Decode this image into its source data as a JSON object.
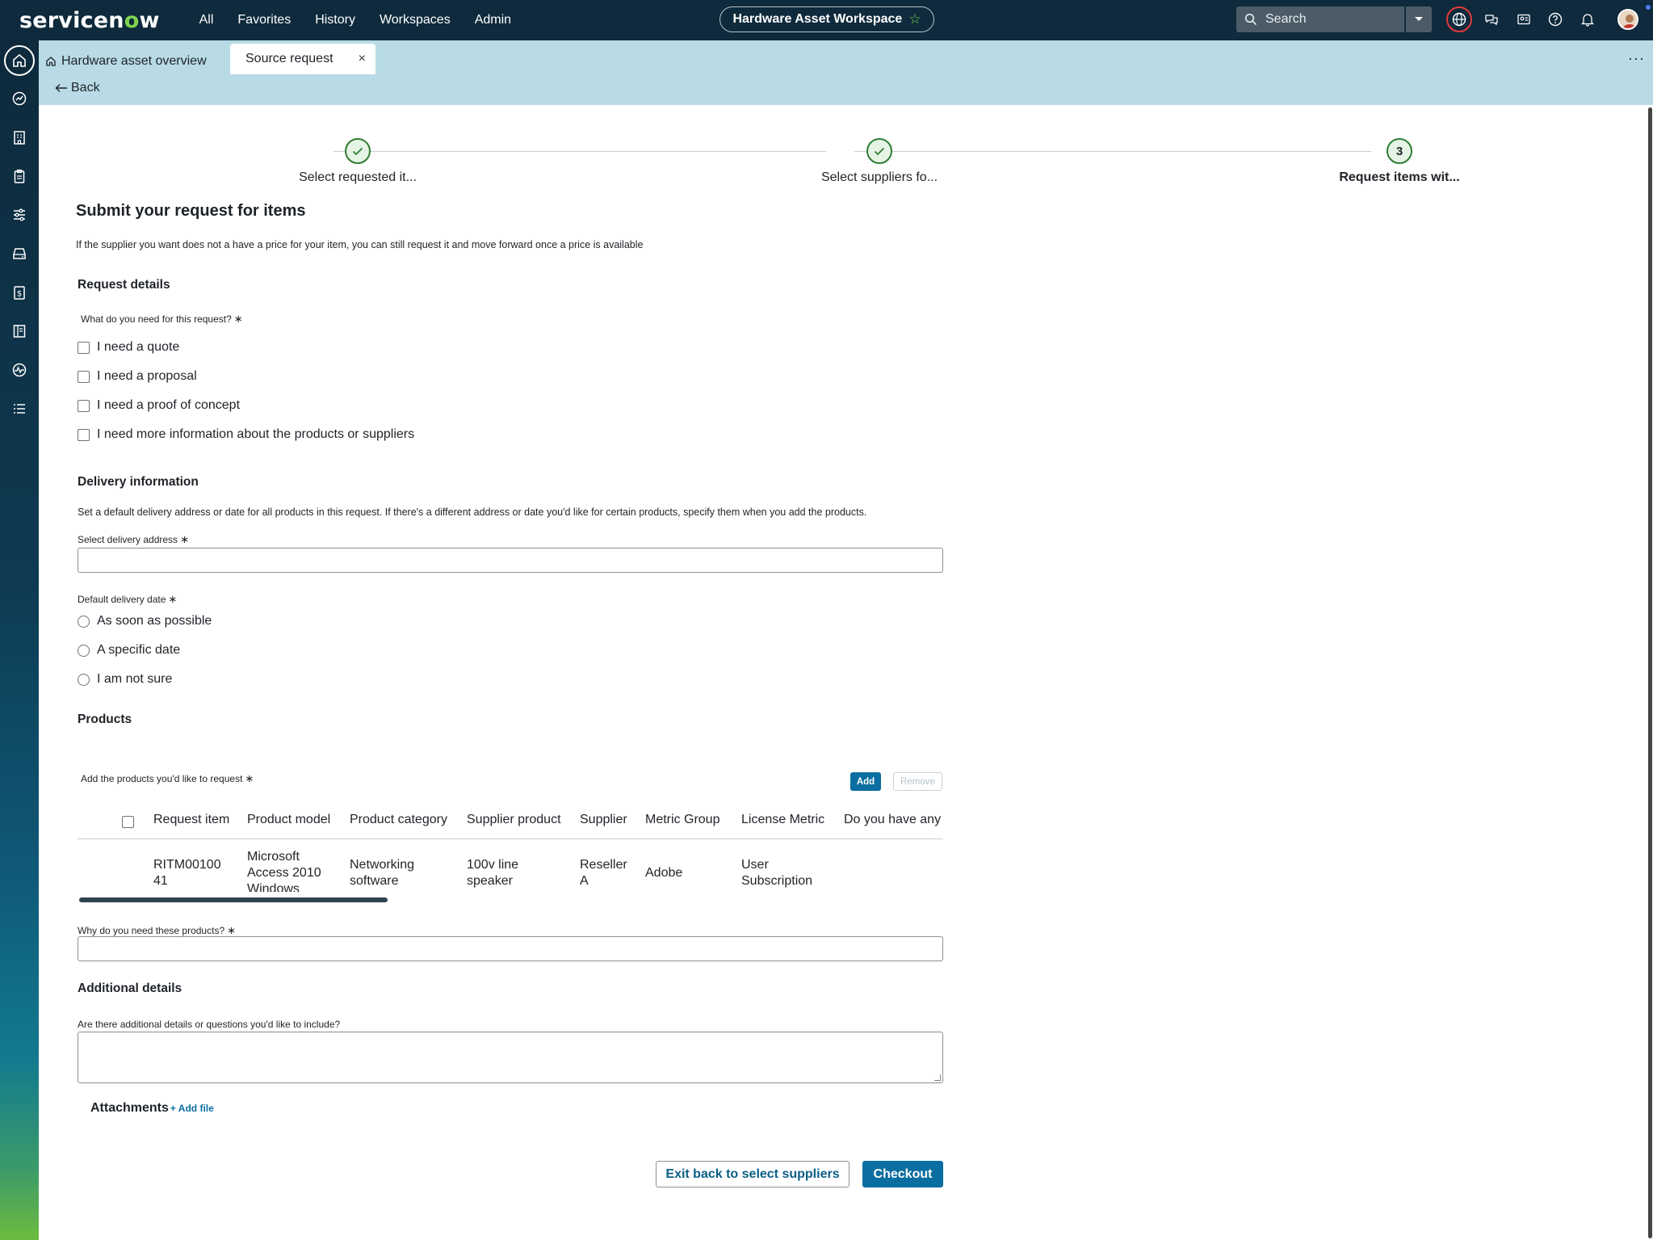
{
  "topbar": {
    "logo_main": "servicen",
    "logo_accent": "o",
    "logo_end": "w",
    "nav": [
      "All",
      "Favorites",
      "History",
      "Workspaces",
      "Admin"
    ],
    "workspace": "Hardware Asset Workspace",
    "search_placeholder": "Search"
  },
  "tabs": {
    "home": "Hardware asset overview",
    "active": "Source request",
    "close": "×",
    "back": "Back",
    "more": "···"
  },
  "stepper": [
    {
      "label": "Select requested it...",
      "state": "done"
    },
    {
      "label": "Select suppliers fo...",
      "state": "done"
    },
    {
      "label": "Request items wit...",
      "state": "current",
      "number": "3"
    }
  ],
  "form": {
    "title": "Submit your request for items",
    "subtitle": "If the supplier you want does not a have a price for your item, you can still request it and move forward once a price is available",
    "request_details": {
      "heading": "Request details",
      "question": "What do you need for this request?",
      "options": [
        "I need a quote",
        "I need a proposal",
        "I need a proof of concept",
        "I need more information about the products or suppliers"
      ]
    },
    "delivery": {
      "heading": "Delivery information",
      "description": "Set a default delivery address or date for all products in this request. If there's a different address or date you'd like for certain products, specify them when you add the products.",
      "address_label": "Select delivery address",
      "date_label": "Default delivery date",
      "date_options": [
        "As soon as possible",
        "A specific date",
        "I am not sure"
      ]
    },
    "products": {
      "heading": "Products",
      "add_label": "Add the products you'd like to request",
      "add_button": "Add",
      "remove_button": "Remove",
      "columns": [
        "Request item",
        "Product model",
        "Product category",
        "Supplier product",
        "Supplier",
        "Metric Group",
        "License Metric",
        "Do you have any r"
      ],
      "rows": [
        {
          "request_item": [
            "RITM00100",
            "41"
          ],
          "product_model": [
            "Microsoft",
            "Access 2010",
            "Windows"
          ],
          "product_category": [
            "Networking",
            "software"
          ],
          "supplier_product": [
            "100v line",
            "speaker"
          ],
          "supplier": [
            "Reseller",
            "A"
          ],
          "metric_group": "Adobe",
          "license_metric": [
            "User",
            "Subscription"
          ]
        }
      ],
      "why_label": "Why do you need these products?"
    },
    "additional": {
      "heading": "Additional details",
      "question": "Are there additional details or questions you'd like to include?"
    },
    "attachments": {
      "label": "Attachments",
      "add_file": "+ Add file"
    },
    "required_mark": "∗",
    "buttons": {
      "exit": "Exit back to select suppliers",
      "checkout": "Checkout"
    }
  },
  "colors": {
    "topbar": "#0e2a3c",
    "tabstrip": "#b8dbe6",
    "primary": "#0b6ea0",
    "brand_green": "#7fd34e",
    "step_done": "#2e7d32"
  }
}
